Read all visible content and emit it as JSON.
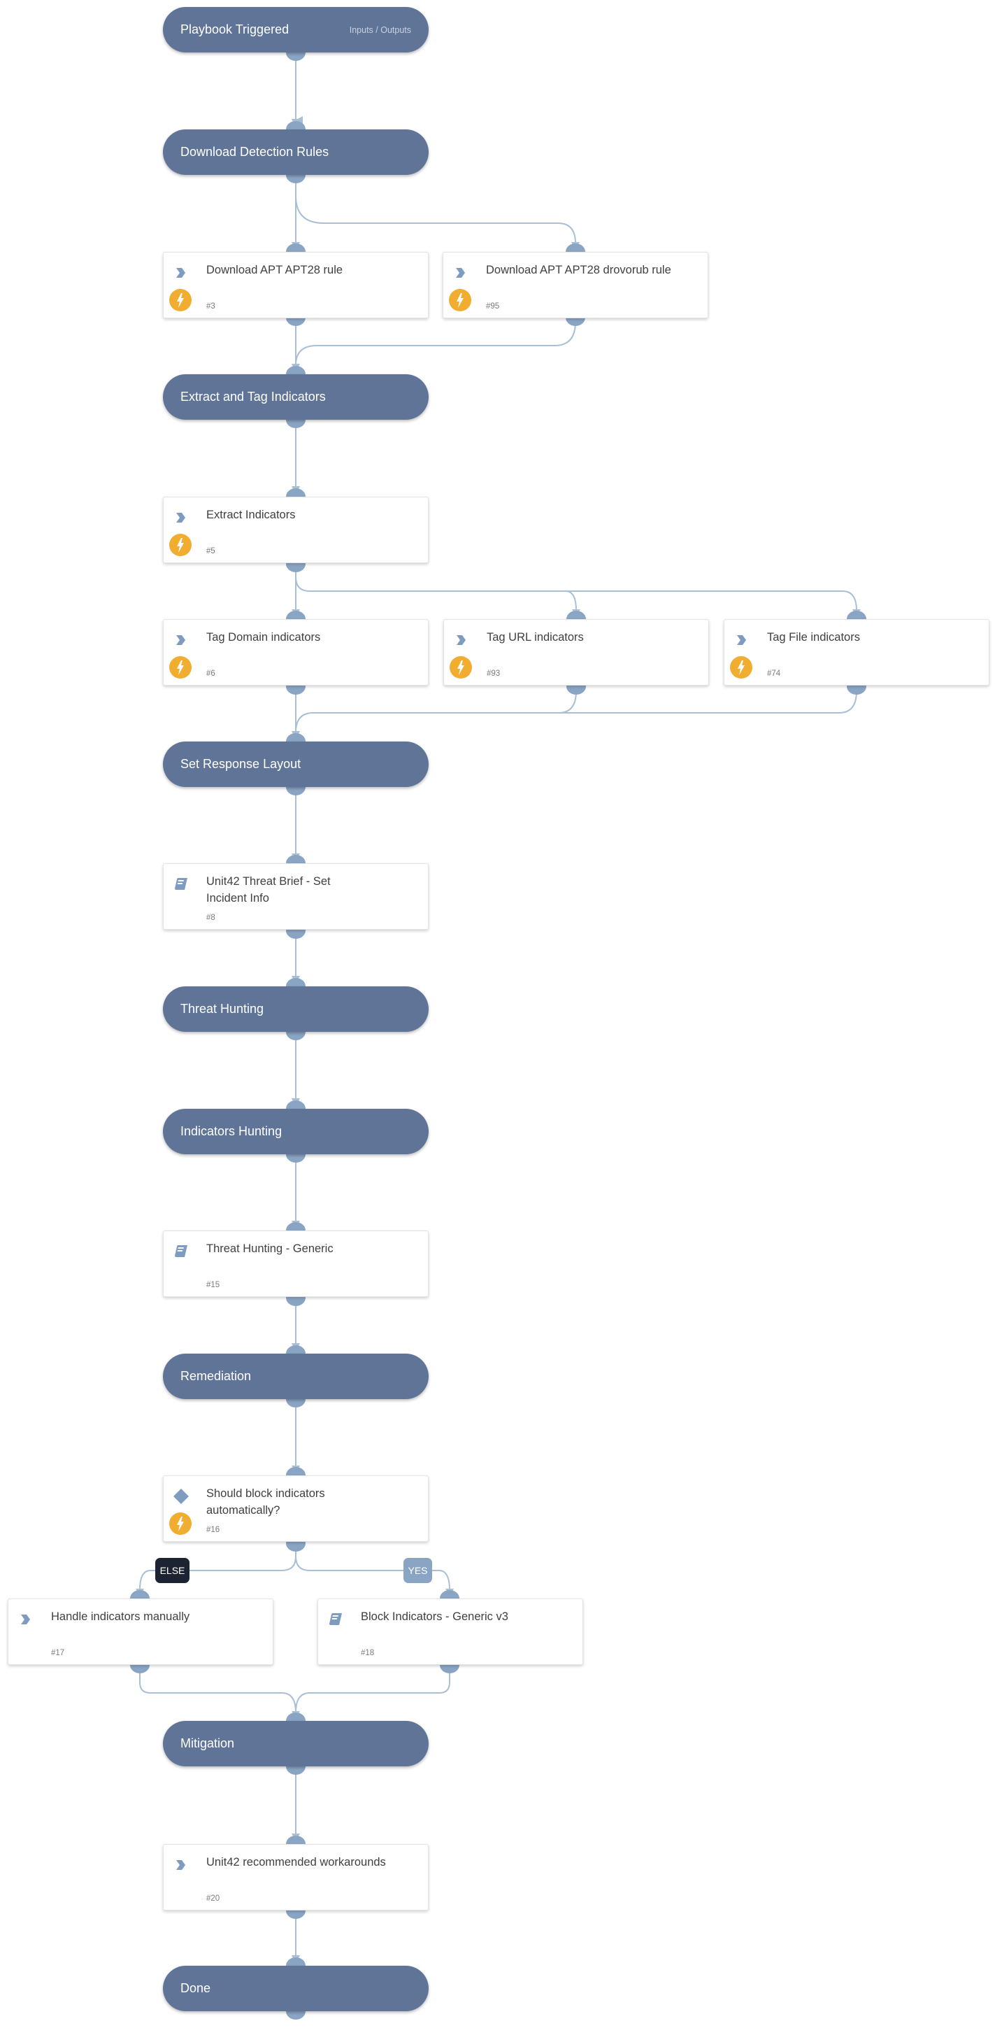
{
  "colors": {
    "section_bg": "#5f7497",
    "port": "#8aa5c4",
    "edge": "#a9bfd6",
    "automation_badge": "#f0ad30",
    "else_badge": "#1c2333",
    "yes_badge": "#8aa5c4",
    "task_icon": "#7f9cc0"
  },
  "header": {
    "title": "Playbook Triggered",
    "io_link": "Inputs / Outputs"
  },
  "sections": {
    "download_rules": "Download Detection Rules",
    "extract_tag": "Extract and Tag Indicators",
    "response_layout": "Set Response Layout",
    "threat_hunting": "Threat Hunting",
    "indicators_hunting": "Indicators Hunting",
    "remediation": "Remediation",
    "mitigation": "Mitigation",
    "done": "Done"
  },
  "tasks": {
    "t3": {
      "name": "Download APT APT28 rule",
      "id": "#3",
      "icon": "chevron-right",
      "automated": true
    },
    "t95": {
      "name": "Download APT APT28 drovorub rule",
      "id": "#95",
      "icon": "chevron-right",
      "automated": true
    },
    "t5": {
      "name": "Extract Indicators",
      "id": "#5",
      "icon": "chevron-right",
      "automated": true
    },
    "t6": {
      "name": "Tag Domain indicators",
      "id": "#6",
      "icon": "chevron-right",
      "automated": true
    },
    "t93": {
      "name": "Tag URL indicators",
      "id": "#93",
      "icon": "chevron-right",
      "automated": true
    },
    "t74": {
      "name": "Tag File indicators",
      "id": "#74",
      "icon": "chevron-right",
      "automated": true
    },
    "t8": {
      "name": "Unit42 Threat Brief - Set Incident Info",
      "id": "#8",
      "icon": "book",
      "automated": false
    },
    "t15": {
      "name": "Threat Hunting - Generic",
      "id": "#15",
      "icon": "book",
      "automated": false
    },
    "t16": {
      "name": "Should block indicators automatically?",
      "id": "#16",
      "icon": "diamond",
      "automated": true
    },
    "t17": {
      "name": "Handle indicators manually",
      "id": "#17",
      "icon": "chevron-right",
      "automated": false
    },
    "t18": {
      "name": "Block Indicators - Generic v3",
      "id": "#18",
      "icon": "book",
      "automated": false
    },
    "t20": {
      "name": "Unit42 recommended workarounds",
      "id": "#20",
      "icon": "chevron-right",
      "automated": false
    }
  },
  "branches": {
    "else_label": "ELSE",
    "yes_label": "YES"
  }
}
